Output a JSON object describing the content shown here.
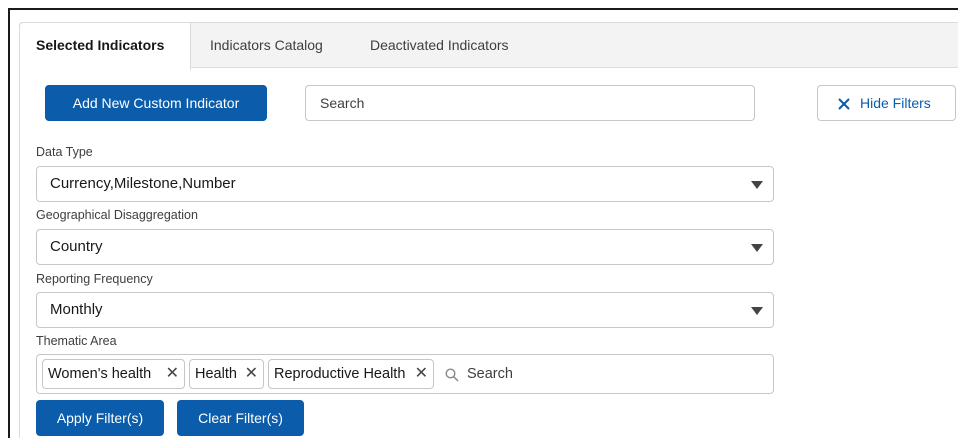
{
  "tabs": [
    {
      "label": "Selected Indicators",
      "active": true
    },
    {
      "label": "Indicators Catalog",
      "active": false
    },
    {
      "label": "Deactivated Indicators",
      "active": false
    }
  ],
  "toolbar": {
    "add_label": "Add New Custom Indicator",
    "search_placeholder": "Search",
    "hide_filters_label": "Hide Filters",
    "hide_filters_icon": "close-icon"
  },
  "filters": {
    "data_type": {
      "label": "Data Type",
      "value": "Currency,Milestone,Number"
    },
    "geo": {
      "label": "Geographical Disaggregation",
      "value": "Country"
    },
    "frequency": {
      "label": "Reporting Frequency",
      "value": "Monthly"
    },
    "thematic": {
      "label": "Thematic Area",
      "pills": [
        "Women's health",
        "Health",
        "Reproductive Health"
      ],
      "search_placeholder": "Search"
    }
  },
  "actions": {
    "apply_label": "Apply Filter(s)",
    "clear_label": "Clear Filter(s)"
  },
  "colors": {
    "brand": "#0b5cab",
    "border": "#c9c7c5",
    "tabbar_bg": "#f3f3f3"
  }
}
